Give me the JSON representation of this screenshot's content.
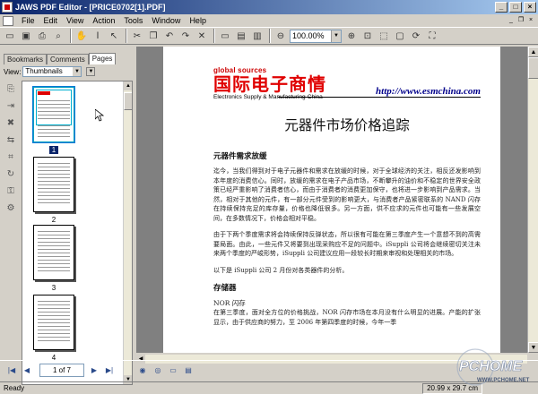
{
  "window": {
    "title": "JAWS PDF Editor - [PRICE0702[1].PDF]"
  },
  "menu": [
    "File",
    "Edit",
    "View",
    "Action",
    "Tools",
    "Window",
    "Help"
  ],
  "toolbar": {
    "zoom": "100.00%"
  },
  "leftpanel": {
    "tabs": [
      "Bookmarks",
      "Comments",
      "Pages"
    ],
    "view_label": "View:",
    "view_value": "Thumbnails",
    "thumbnails": [
      {
        "num": "1"
      },
      {
        "num": "2"
      },
      {
        "num": "3"
      },
      {
        "num": "4"
      }
    ]
  },
  "document": {
    "logo_brand": "global sources",
    "logo_cn": "国际电子商情",
    "logo_en": "Electronics Supply & Manufacturing-China",
    "url": "http://www.esmchina.com",
    "headline": "元器件市场价格追踪",
    "section1_title": "元器件需求放缓",
    "para1": "迄今，当我们得到对于电子元器件和需求在放缓的时候，对于全球经济的关注，相反还发影响到本年度的消费信心。同时，放缓的需求在电子产品市场，不断攀升的油价和不稳定的世界安全政策已经严重影响了消费者信心，而由于消费者的消费更加保守，也将进一步影响到产品需求。当然，相对于其他的元件，有一部分元件受到的影响更大，与消费者产品紧密联系的 NAND 闪存在持续保持充足的库存量，价格也降低很多。另一方面，供不应求的元件也可能有一些发展空间，在多数情况下，价格会相对平稳。",
    "para2": "由于下两个季度需求将会持续保持反弹状态，所以很有可能在第三季度产生一个意想不到的高需要局面。由此，一些元件又将要到出现采购应不足的问题中。iSuppli 公司将会继续密切关注未来两个季度的严峻形势，iSuppli 公司建议应用一段较长时期来审视和处理相关的市场。",
    "para3": "以下是 iSuppli 公司 2 月份对各类器件的分析。",
    "section2_title": "存储器",
    "sub1": "NOR 闪存",
    "para4": "在第三季度，面对全方位的价格挑战，NOR 闪存市场在本月没有什么明显的进展。产能的扩张显示，由于供应商的努力，至 2006 年第四季度的时候，今年一季"
  },
  "nav": {
    "page_indicator": "1 of 7"
  },
  "status": {
    "text": "Ready",
    "dims": "20.99 x 29.7 cm"
  },
  "watermark": {
    "brand": "PCHOME",
    "site": "WWW.PCHOME.NET"
  }
}
